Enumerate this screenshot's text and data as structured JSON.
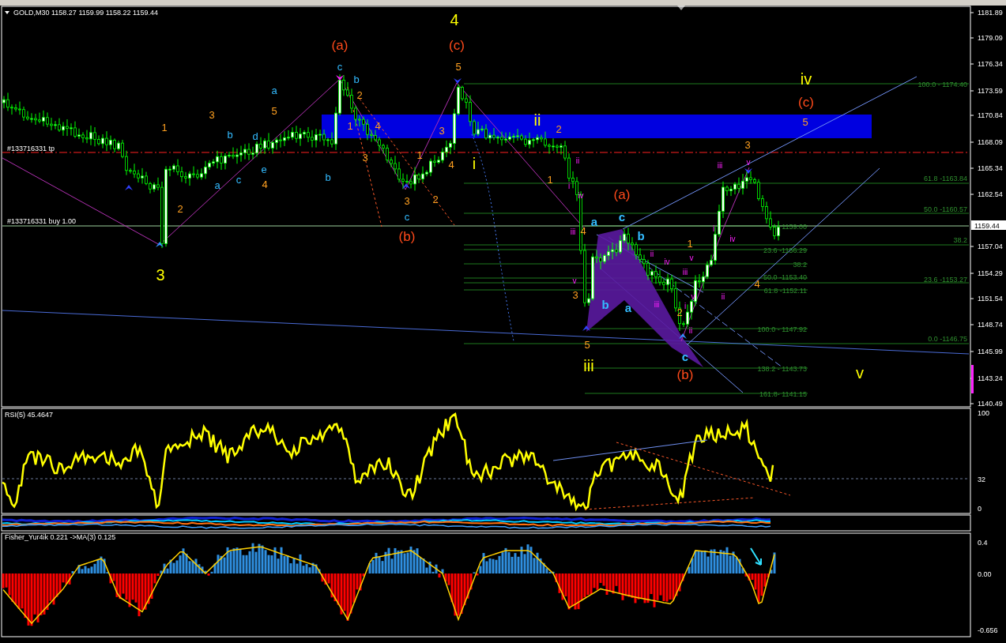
{
  "chart_title": "GOLD,M30  1158.27 1159.99 1158.22 1159.44",
  "price_axis": [
    "1181.89",
    "1179.09",
    "1176.34",
    "1173.59",
    "1170.84",
    "1168.09",
    "1165.34",
    "1162.54",
    "1157.04",
    "1154.29",
    "1151.54",
    "1148.74",
    "1145.99",
    "1143.24",
    "1140.49"
  ],
  "current_price": "1159.44",
  "order_lines": [
    "#133716331 tp",
    "#133716331 buy 1.00"
  ],
  "wave_labels": [
    {
      "text": "4",
      "kind": "primary"
    },
    {
      "text": "3",
      "kind": "primary"
    },
    {
      "text": "iv",
      "kind": "primary"
    },
    {
      "text": "ii",
      "kind": "primary"
    },
    {
      "text": "i",
      "kind": "primary"
    },
    {
      "text": "iii",
      "kind": "primary"
    },
    {
      "text": "v",
      "kind": "primary"
    },
    {
      "text": "(a)",
      "kind": "intermediate"
    },
    {
      "text": "(c)",
      "kind": "intermediate"
    },
    {
      "text": "(b)",
      "kind": "intermediate"
    },
    {
      "text": "(a)",
      "kind": "intermediate"
    },
    {
      "text": "(b)",
      "kind": "intermediate"
    },
    {
      "text": "(c)",
      "kind": "intermediate"
    },
    {
      "text": "1",
      "kind": "minor"
    },
    {
      "text": "3",
      "kind": "minor"
    },
    {
      "text": "5",
      "kind": "minor"
    },
    {
      "text": "2",
      "kind": "minor"
    },
    {
      "text": "4",
      "kind": "minor"
    },
    {
      "text": "2",
      "kind": "minor"
    },
    {
      "text": "1",
      "kind": "minor"
    },
    {
      "text": "4",
      "kind": "minor"
    },
    {
      "text": "3",
      "kind": "minor"
    },
    {
      "text": "3",
      "kind": "minor"
    },
    {
      "text": "1",
      "kind": "minor"
    },
    {
      "text": "3",
      "kind": "minor"
    },
    {
      "text": "4",
      "kind": "minor"
    },
    {
      "text": "2",
      "kind": "minor"
    },
    {
      "text": "5",
      "kind": "minor"
    },
    {
      "text": "2",
      "kind": "minor"
    },
    {
      "text": "1",
      "kind": "minor"
    },
    {
      "text": "3",
      "kind": "minor"
    },
    {
      "text": "5",
      "kind": "minor"
    },
    {
      "text": "1",
      "kind": "minor"
    },
    {
      "text": "3",
      "kind": "minor"
    },
    {
      "text": "4",
      "kind": "minor"
    },
    {
      "text": "2",
      "kind": "minor"
    },
    {
      "text": "5",
      "kind": "minor"
    },
    {
      "text": "4",
      "kind": "minor"
    },
    {
      "text": "c",
      "kind": "minute"
    },
    {
      "text": "b",
      "kind": "minute"
    },
    {
      "text": "a",
      "kind": "minute"
    },
    {
      "text": "b",
      "kind": "minute"
    },
    {
      "text": "d",
      "kind": "minute"
    },
    {
      "text": "e",
      "kind": "minute"
    },
    {
      "text": "c",
      "kind": "minute"
    },
    {
      "text": "a",
      "kind": "minute"
    },
    {
      "text": "b",
      "kind": "minute"
    },
    {
      "text": "c",
      "kind": "minute"
    },
    {
      "text": "a",
      "kind": "minute_bold"
    },
    {
      "text": "c",
      "kind": "minute_bold"
    },
    {
      "text": "b",
      "kind": "minute_bold"
    },
    {
      "text": "b",
      "kind": "minute_bold"
    },
    {
      "text": "a",
      "kind": "minute_bold"
    },
    {
      "text": "c",
      "kind": "minute_bold"
    },
    {
      "text": "ii",
      "kind": "subminuette"
    },
    {
      "text": "i",
      "kind": "subminuette"
    },
    {
      "text": "iv",
      "kind": "subminuette"
    },
    {
      "text": "iii",
      "kind": "subminuette"
    },
    {
      "text": "v",
      "kind": "subminuette"
    },
    {
      "text": "ii",
      "kind": "subminuette"
    },
    {
      "text": "iv",
      "kind": "subminuette"
    },
    {
      "text": "v",
      "kind": "subminuette"
    },
    {
      "text": "iii",
      "kind": "subminuette"
    },
    {
      "text": "v",
      "kind": "subminuette"
    },
    {
      "text": "i",
      "kind": "subminuette"
    },
    {
      "text": "ii",
      "kind": "subminuette"
    },
    {
      "text": "iii",
      "kind": "subminuette"
    },
    {
      "text": "ii",
      "kind": "subminuette"
    },
    {
      "text": "i",
      "kind": "subminuette"
    },
    {
      "text": "iv",
      "kind": "subminuette"
    },
    {
      "text": "iii",
      "kind": "subminuette"
    },
    {
      "text": "v",
      "kind": "subminuette"
    }
  ],
  "fib_labels": [
    "100.0 - 1174.40",
    "61.8 -1163.84",
    "50.0 -1160.57",
    "1159.00",
    "38.2",
    "23.6 -1156.29",
    "38.2",
    "50.0 -1153.40",
    "23.6 -1153.27",
    "61.8 -1152.11",
    "100.0 - 1147.92",
    "0.0 -1146.75",
    "138.2 - 1143.73",
    "161.8- 1141.15"
  ],
  "rsi": {
    "title": "RSI(5) 45.4647",
    "axis": [
      "100",
      "32",
      "0"
    ]
  },
  "fisher": {
    "title": "Fisher_Yur4ik 0.221  ->MA(3) 0.125",
    "axis": [
      "0.4",
      "0.00",
      "-0.656"
    ]
  }
}
